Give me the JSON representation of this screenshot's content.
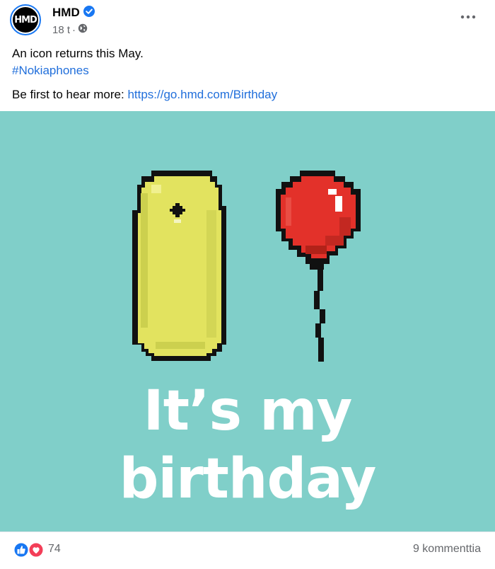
{
  "post": {
    "author": "HMD",
    "avatar_text": "HMD",
    "timestamp": "18 t",
    "separator": "·",
    "text_line1": "An icon returns this May.",
    "hashtag": "#Nokiaphones",
    "text_prefix": "Be first to hear more: ",
    "link": "https://go.hmd.com/Birthday"
  },
  "image": {
    "headline_line1": "It’s my",
    "headline_line2": "birthday"
  },
  "footer": {
    "reaction_count": "74",
    "comments": "9 kommenttia"
  },
  "colors": {
    "image_bg": "#80cfc9",
    "phone_yellow": "#e2e35f",
    "balloon_red": "#e3312a",
    "link_blue": "#216fdb",
    "like_blue": "#1877f2",
    "love_red": "#f33e58"
  },
  "icons": [
    "verified-badge-icon",
    "globe-icon",
    "more-options-icon",
    "like-reaction-icon",
    "love-reaction-icon"
  ]
}
